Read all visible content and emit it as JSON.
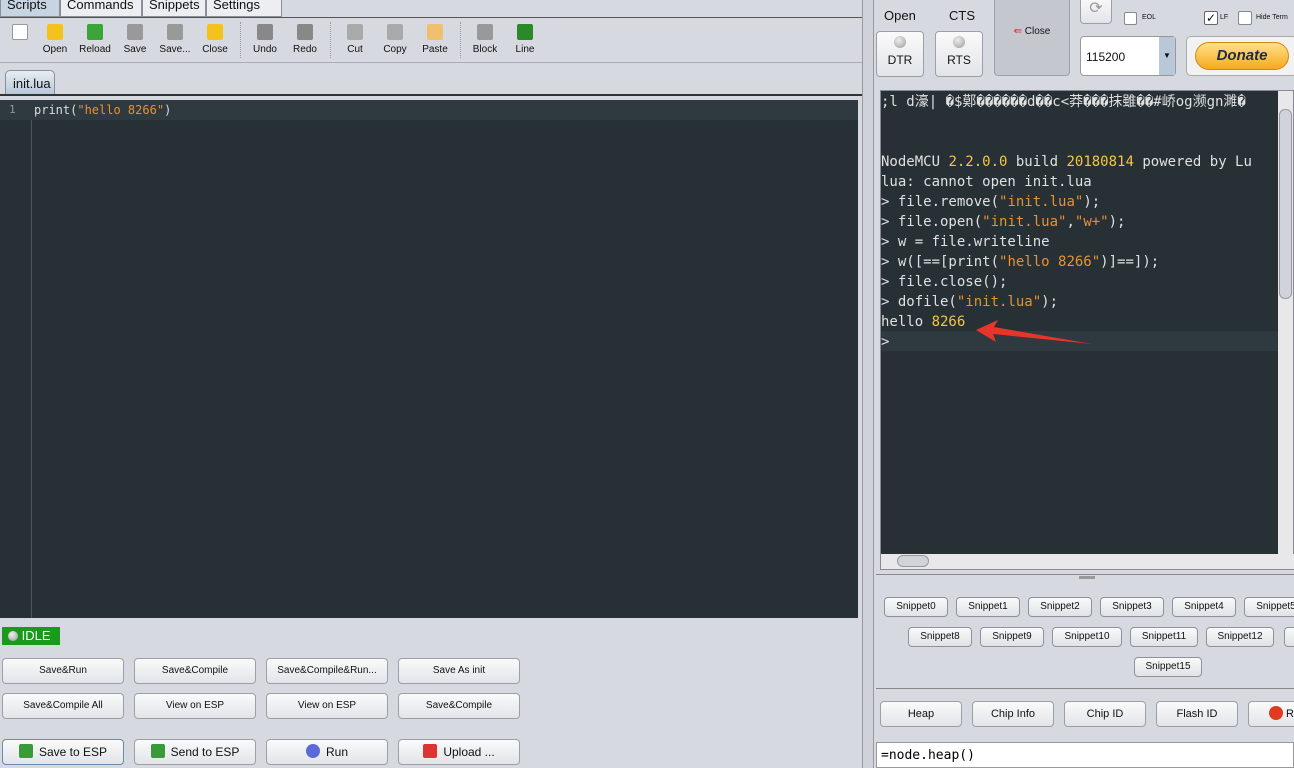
{
  "left": {
    "tabs": [
      "Scripts",
      "Commands",
      "Snippets",
      "Settings"
    ],
    "toolbar": [
      {
        "label": "",
        "icon": "new-file-icon"
      },
      {
        "label": "Open",
        "icon": "folder-open-icon"
      },
      {
        "label": "Reload",
        "icon": "reload-icon"
      },
      {
        "label": "Save",
        "icon": "save-icon"
      },
      {
        "label": "Save...",
        "icon": "save-as-icon"
      },
      {
        "label": "Close",
        "icon": "close-file-icon"
      },
      {
        "label": "Undo",
        "icon": "undo-icon"
      },
      {
        "label": "Redo",
        "icon": "redo-icon"
      },
      {
        "label": "Cut",
        "icon": "cut-icon"
      },
      {
        "label": "Copy",
        "icon": "copy-icon"
      },
      {
        "label": "Paste",
        "icon": "paste-icon"
      },
      {
        "label": "Block",
        "icon": "block-icon"
      },
      {
        "label": "Line",
        "icon": "line-icon"
      }
    ],
    "file_tab": "init.lua",
    "editor": {
      "line_number": "1",
      "code_pre": "print(",
      "code_str": "\"hello 8266\"",
      "code_post": ")"
    },
    "status": "IDLE",
    "buttons_row1": [
      "Save&Run",
      "Save&Compile",
      "Save&Compile&Run...",
      "Save As init"
    ],
    "buttons_row2": [
      "Save&Compile All",
      "View on ESP",
      "View on ESP",
      "Save&Compile"
    ],
    "buttons_row3": [
      {
        "label": "Save to ESP",
        "icon": "save-to-esp-icon"
      },
      {
        "label": "Send to ESP",
        "icon": "send-to-esp-icon"
      },
      {
        "label": "Run",
        "icon": "run-icon"
      },
      {
        "label": "Upload ...",
        "icon": "upload-icon"
      }
    ]
  },
  "right": {
    "open": "Open",
    "cts": "CTS",
    "dtr": "DTR",
    "rts": "RTS",
    "close": "Close",
    "eol": "EOL",
    "lf": "LF",
    "lf_checked": true,
    "hide_term": "Hide Term",
    "baud": "115200",
    "donate": "Donate",
    "terminal": [
      [
        [
          "txt",
          ";l d濠| �$鄚������d��c<莽���抹雖��#峤og濒gn濉�"
        ]
      ],
      [],
      [],
      [
        [
          "txt",
          "NodeMCU "
        ],
        [
          "num",
          "2.2.0.0"
        ],
        [
          "txt",
          " build "
        ],
        [
          "num",
          "20180814"
        ],
        [
          "txt",
          " powered by Lu"
        ]
      ],
      [
        [
          "txt",
          "lua: cannot open init.lua"
        ]
      ],
      [
        [
          "txt",
          "> file.remove("
        ],
        [
          "str",
          "\"init.lua\""
        ],
        [
          "txt",
          ");"
        ]
      ],
      [
        [
          "txt",
          "> file.open("
        ],
        [
          "str",
          "\"init.lua\""
        ],
        [
          "txt",
          ","
        ],
        [
          "str",
          "\"w+\""
        ],
        [
          "txt",
          ");"
        ]
      ],
      [
        [
          "txt",
          "> w = file.writeline"
        ]
      ],
      [
        [
          "txt",
          "> w([==[print("
        ],
        [
          "str",
          "\"hello 8266\""
        ],
        [
          "txt",
          ")]==]);"
        ]
      ],
      [
        [
          "txt",
          "> file.close();"
        ]
      ],
      [
        [
          "txt",
          "> dofile("
        ],
        [
          "str",
          "\"init.lua\""
        ],
        [
          "txt",
          ");"
        ]
      ],
      [
        [
          "txt",
          "hello "
        ],
        [
          "num",
          "8266"
        ]
      ],
      [
        [
          "txt",
          ">"
        ]
      ]
    ],
    "snippets_row1": [
      "Snippet0",
      "Snippet1",
      "Snippet2",
      "Snippet3",
      "Snippet4",
      "Snippet5"
    ],
    "snippets_row2": [
      "Snippet8",
      "Snippet9",
      "Snippet10",
      "Snippet11",
      "Snippet12",
      ""
    ],
    "snippets_row3": [
      "Snippet15"
    ],
    "cmd_buttons": [
      "Heap",
      "Chip Info",
      "Chip ID",
      "Flash ID",
      "R"
    ],
    "command_input": "=node.heap()",
    "accent_arrow": "#e8352b"
  }
}
